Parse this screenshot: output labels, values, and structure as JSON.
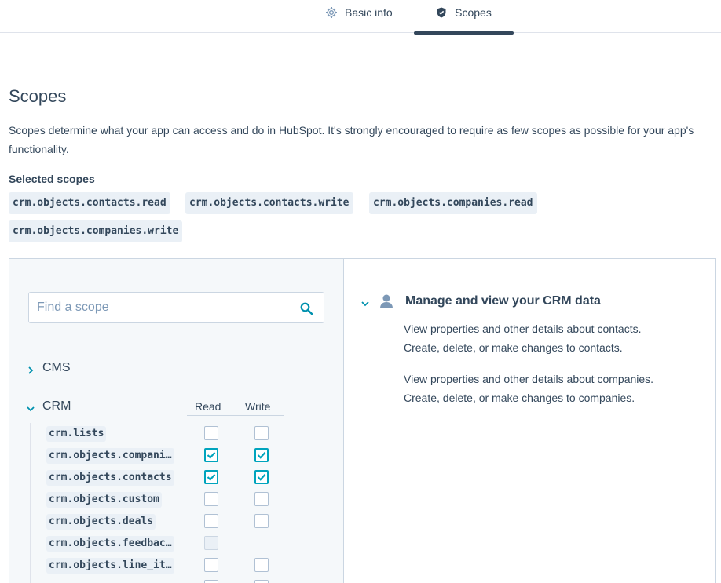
{
  "tabs": [
    {
      "label": "Basic info",
      "icon": "gear-icon",
      "active": false
    },
    {
      "label": "Scopes",
      "icon": "shield-icon",
      "active": true
    }
  ],
  "page": {
    "title": "Scopes",
    "description": "Scopes determine what your app can access and do in HubSpot. It's strongly encouraged to require as few scopes as possible for your app's functionality.",
    "selected_label": "Selected scopes"
  },
  "selected_scopes": [
    "crm.objects.contacts.read",
    "crm.objects.contacts.write",
    "crm.objects.companies.read",
    "crm.objects.companies.write"
  ],
  "search": {
    "placeholder": "Find a scope"
  },
  "groups": [
    {
      "label": "CMS",
      "expanded": false
    },
    {
      "label": "CRM",
      "expanded": true
    }
  ],
  "columns": {
    "read": "Read",
    "write": "Write"
  },
  "crm_rows": [
    {
      "name": "crm.lists",
      "read": false,
      "write": false
    },
    {
      "name": "crm.objects.compani…",
      "read": true,
      "write": true
    },
    {
      "name": "crm.objects.contacts",
      "read": true,
      "write": true
    },
    {
      "name": "crm.objects.custom",
      "read": false,
      "write": false
    },
    {
      "name": "crm.objects.deals",
      "read": false,
      "write": false
    },
    {
      "name": "crm.objects.feedbac…",
      "read": false,
      "write": null,
      "read_disabled": true
    },
    {
      "name": "crm.objects.line_it…",
      "read": false,
      "write": false
    },
    {
      "name": "",
      "read": false,
      "write": false
    }
  ],
  "details": {
    "title": "Manage and view your CRM data",
    "lines": [
      "View properties and other details about contacts.",
      "Create, delete, or make changes to contacts.",
      "View properties and other details about companies.",
      "Create, delete, or make changes to companies."
    ]
  },
  "colors": {
    "accent": "#00a4bd",
    "text": "#33475b",
    "chip_bg": "#eaf0f6",
    "panel_bg": "#f5f8fa"
  }
}
